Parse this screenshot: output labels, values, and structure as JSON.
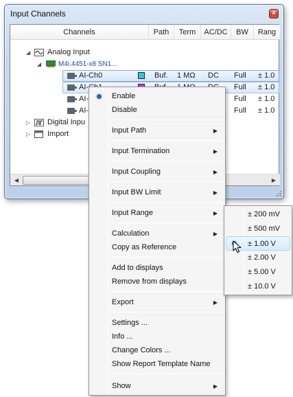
{
  "window": {
    "title": "Input Channels",
    "close_glyph": "×"
  },
  "columns": [
    "Channels",
    "Path",
    "Term",
    "AC/DC",
    "BW",
    "Rang"
  ],
  "tree": {
    "analog": "Analog Input",
    "device": "M4i.4451-x8 SN1...",
    "channels": [
      {
        "name": "AI-Ch0",
        "color": "#29c7e4",
        "path": "Buf.",
        "term": "1 MΩ",
        "acdc": "DC",
        "bw": "Full",
        "range": "± 1.0"
      },
      {
        "name": "AI-Ch1",
        "color": "#c83ad6",
        "path": "Buf.",
        "term": "1 MΩ",
        "acdc": "DC",
        "bw": "Full",
        "range": "± 1.0"
      },
      {
        "name": "AI-C",
        "bw": "Full",
        "range": "± 1.0"
      },
      {
        "name": "AI-C",
        "bw": "Full",
        "range": "± 1.0"
      }
    ],
    "digital": "Digital Inpu",
    "import": "Import"
  },
  "context_menu": {
    "enable": "Enable",
    "disable": "Disable",
    "input_path": "Input Path",
    "input_termination": "Input Termination",
    "input_coupling": "Input Coupling",
    "input_bw_limit": "Input BW Limit",
    "input_range": "Input Range",
    "calculation": "Calculation",
    "copy_as_reference": "Copy as Reference",
    "add_to_displays": "Add to displays",
    "remove_from_displays": "Remove from displays",
    "export": "Export",
    "settings": "Settings ...",
    "info": "Info ...",
    "change_colors": "Change Colors ...",
    "show_report_template_name": "Show Report Template Name",
    "show": "Show",
    "selected": "Enable"
  },
  "range_submenu": {
    "options": [
      "± 200 mV",
      "± 500 mV",
      "± 1.00 V",
      "± 2.00 V",
      "± 5.00 V",
      "± 10.0 V"
    ],
    "selected": "± 1.00 V"
  },
  "icons": {
    "expand_open": "◢",
    "expand_closed": "▷",
    "submenu_arrow": "▶",
    "scroll_left": "◀",
    "scroll_right": "▶"
  }
}
